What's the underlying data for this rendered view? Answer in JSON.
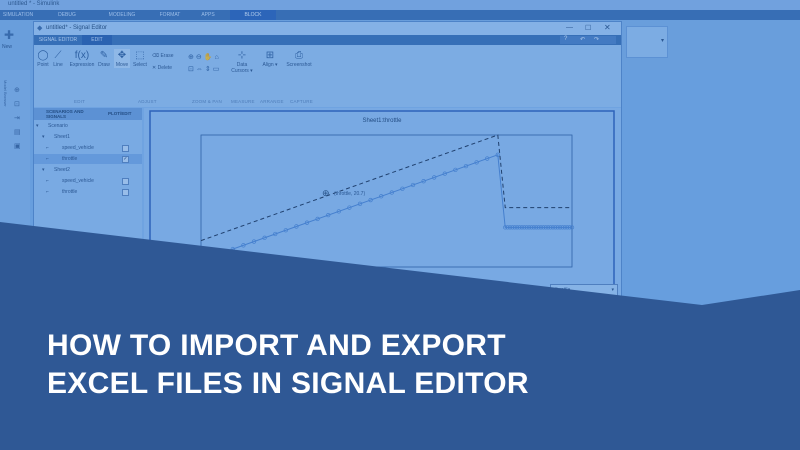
{
  "app": {
    "window_title": "untitled * - Simulink",
    "tabs": [
      "SIMULATION",
      "DEBUG",
      "MODELING",
      "FORMAT",
      "APPS",
      "BLOCK"
    ],
    "left_panel_label": "Model Browser",
    "new_label": "New"
  },
  "signal_editor": {
    "title": "untitled* - Signal Editor",
    "tabs": [
      "SIGNAL EDITOR",
      "EDIT"
    ],
    "tools": [
      {
        "label": "Point",
        "icon": "point-icon"
      },
      {
        "label": "Line",
        "icon": "line-icon"
      },
      {
        "label": "Expression",
        "icon": "expression-icon"
      },
      {
        "label": "Draw",
        "icon": "pencil-icon"
      },
      {
        "label": "Move",
        "icon": "move-icon"
      },
      {
        "label": "Select",
        "icon": "select-icon"
      },
      {
        "label": "Erase",
        "icon": "eraser-icon"
      },
      {
        "label": "Delete",
        "icon": "delete-icon"
      },
      {
        "label": "Data Cursors",
        "icon": "data-cursor-icon"
      },
      {
        "label": "Align",
        "icon": "align-icon"
      },
      {
        "label": "Screenshot",
        "icon": "screenshot-icon"
      }
    ],
    "sections": [
      "EDIT",
      "ADJUST",
      "ZOOM & PAN",
      "MEASURE",
      "ARRANGE",
      "CAPTURE"
    ],
    "tree": {
      "col_scenarios": "SCENARIOS AND SIGNALS",
      "col_plot": "PLOT/EDIT",
      "rows": [
        {
          "label": "Scenario",
          "checked": false
        },
        {
          "label": "Sheet1",
          "checked": false
        },
        {
          "label": "speed_vehicle",
          "checked": false
        },
        {
          "label": "throttle",
          "checked": true
        },
        {
          "label": "Sheet2",
          "checked": false
        },
        {
          "label": "speed_vehicle",
          "checked": false
        },
        {
          "label": "throttle",
          "checked": false
        }
      ]
    },
    "plot": {
      "title": "Sheet1:throttle",
      "datatip": "(throttle, 20.7)",
      "dropdown_value": "throttle"
    }
  },
  "chart_data": {
    "type": "line",
    "title": "Sheet1:throttle",
    "series": [
      {
        "style": "dashed",
        "x": [
          0,
          80,
          82,
          100
        ],
        "y": [
          0.2,
          1.0,
          0.45,
          0.45
        ]
      },
      {
        "style": "markers",
        "x": [
          0,
          80,
          82,
          100
        ],
        "y": [
          0.05,
          0.85,
          0.3,
          0.3
        ]
      }
    ],
    "xlim": [
      0,
      100
    ],
    "ylim": [
      0,
      1
    ]
  },
  "banner": {
    "line1": "HOW TO IMPORT AND EXPORT",
    "line2": "EXCEL FILES IN SIGNAL EDITOR",
    "colors": {
      "band": "#2f5895",
      "overlay": "#2a6fc9"
    }
  }
}
